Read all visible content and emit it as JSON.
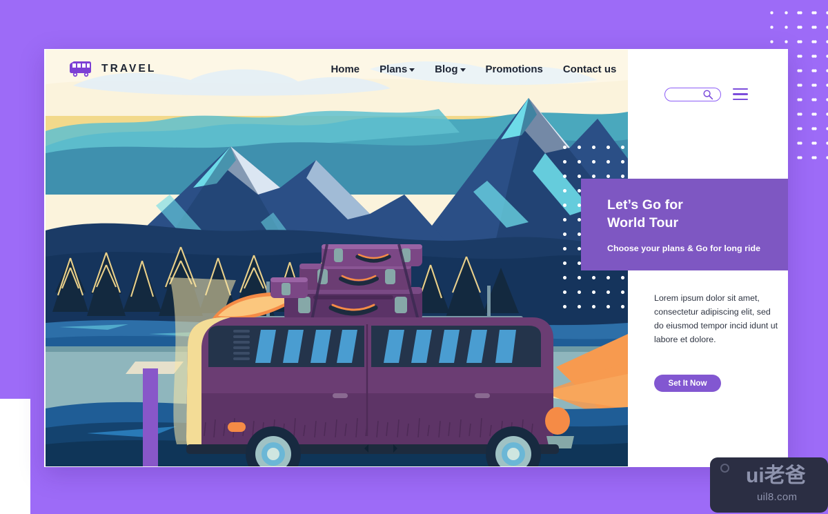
{
  "brand": {
    "name": "TRAVEL",
    "logo_icon": "bus-icon"
  },
  "nav": {
    "items": [
      {
        "label": "Home",
        "has_dropdown": false
      },
      {
        "label": "Plans",
        "has_dropdown": true
      },
      {
        "label": "Blog",
        "has_dropdown": true
      },
      {
        "label": "Promotions",
        "has_dropdown": false
      },
      {
        "label": "Contact us",
        "has_dropdown": false
      }
    ]
  },
  "rail": {
    "search_placeholder": "",
    "search_icon": "search-icon",
    "menu_icon": "hamburger-menu-icon"
  },
  "hero": {
    "title_line1": "Let’s Go for",
    "title_line2": "World Tour",
    "subtitle": "Choose your plans &  Go for long ride"
  },
  "body": {
    "paragraph": "Lorem ipsum dolor sit amet, consectetur adipiscing elit, sed do eiusmod tempor incid idunt ut labore et dolore.",
    "cta_label": "Set It Now"
  },
  "watermark": {
    "main": "ui老爸",
    "sub": "uil8.com"
  },
  "colors": {
    "background_purple": "#9d6bf7",
    "card_purple": "#7e57c2",
    "cta_purple": "#8257d1",
    "accent_violet": "#8b5cf6",
    "text_dark": "#1d2433",
    "sky_cream": "#fbf3dc",
    "mountain_deep": "#1b3b66",
    "mountain_mid": "#2b4f86",
    "snow_cyan": "#6ddbe8",
    "van_purple": "#6b3d73",
    "window_blue": "#4a9dd1",
    "road_teal": "#8fb6bd",
    "sun_orange": "#f79a4f",
    "watermark_bg": "#2b2e43"
  },
  "illustration": {
    "scene": "retro van with stacked luggage and surfboard driving past snowy mountains and pine forest at dusk",
    "elements": [
      "sky",
      "clouds",
      "mountains",
      "pine-forest",
      "lake",
      "van",
      "suitcases",
      "surfboard",
      "headlight-beam",
      "road"
    ]
  }
}
